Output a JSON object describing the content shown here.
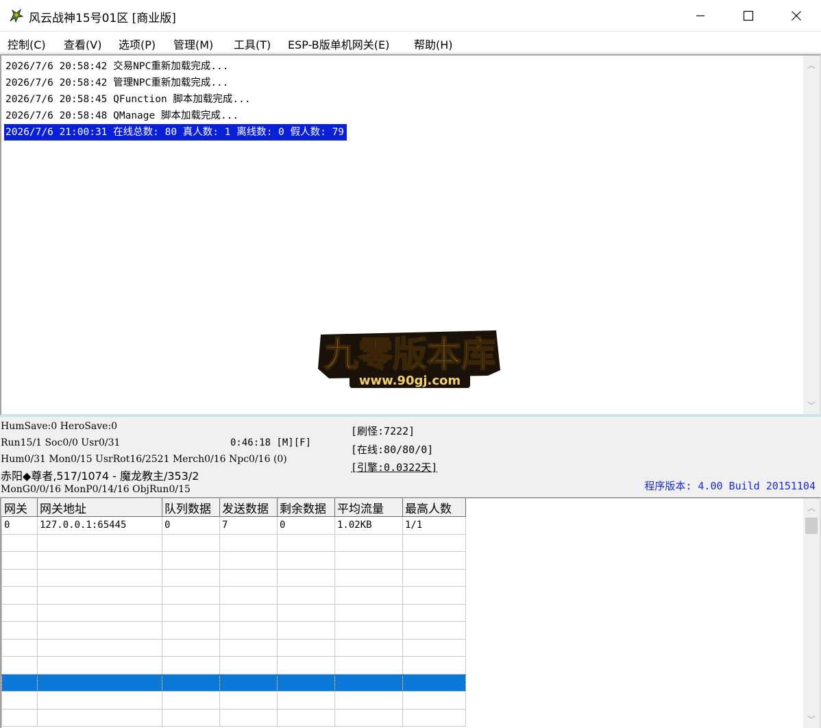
{
  "window": {
    "title": "风云战神15号01区 [商业版]"
  },
  "menu": {
    "items": [
      "控制(C)",
      "查看(V)",
      "选项(P)",
      "管理(M)",
      "工具(T)",
      "ESP-B版单机网关(E)",
      "帮助(H)"
    ]
  },
  "log": {
    "lines": [
      "2026/7/6 20:58:42 交易NPC重新加载完成...",
      "2026/7/6 20:58:42 管理NPC重新加载完成...",
      "2026/7/6 20:58:45 QFunction 脚本加载完成...",
      "2026/7/6 20:58:48 QManage 脚本加载完成...",
      "2026/7/6 21:00:31 在线总数: 80 真人数: 1 离线数: 0 假人数: 79"
    ],
    "selected_index": 4
  },
  "watermark": {
    "text": "九零版本库",
    "url": "www.90gj.com"
  },
  "status": {
    "line1": "HumSave:0 HeroSave:0",
    "line2": "Run15/1 Soc0/0 Usr0/31",
    "timer": "0:46:18 [M][F]",
    "line3": "Hum0/31 Mon0/15 UsrRot16/2521 Merch0/16 Npc0/16 (0)",
    "line4": "赤阳◆尊者,517/1074 - 魔龙教主/353/2",
    "line5": "MonG0/0/16 MonP0/14/16 ObjRun0/15",
    "refresh": "[刷怪:7222]",
    "online": "[在线:80/80/0]",
    "engine": "[引擎:0.0322天]",
    "version": "程序版本: 4.00 Build 20151104"
  },
  "grid": {
    "columns": [
      "网关",
      "网关地址",
      "队列数据",
      "发送数据",
      "剩余数据",
      "平均流量",
      "最高人数"
    ],
    "rows": [
      [
        "0",
        "127.0.0.1:65445",
        "0",
        "7",
        "0",
        "1.02KB",
        "1/1"
      ],
      [
        "",
        "",
        "",
        "",
        "",
        "",
        ""
      ],
      [
        "",
        "",
        "",
        "",
        "",
        "",
        ""
      ],
      [
        "",
        "",
        "",
        "",
        "",
        "",
        ""
      ],
      [
        "",
        "",
        "",
        "",
        "",
        "",
        ""
      ],
      [
        "",
        "",
        "",
        "",
        "",
        "",
        ""
      ],
      [
        "",
        "",
        "",
        "",
        "",
        "",
        ""
      ],
      [
        "",
        "",
        "",
        "",
        "",
        "",
        ""
      ],
      [
        "",
        "",
        "",
        "",
        "",
        "",
        ""
      ],
      [
        "",
        "",
        "",
        "",
        "",
        "",
        ""
      ],
      [
        "",
        "",
        "",
        "",
        "",
        "",
        ""
      ],
      [
        "",
        "",
        "",
        "",
        "",
        "",
        ""
      ]
    ],
    "selected_row": 9
  },
  "icons": {
    "app": "dragon-app-icon",
    "minimize": "minimize-icon",
    "maximize": "maximize-icon",
    "close": "close-icon"
  }
}
